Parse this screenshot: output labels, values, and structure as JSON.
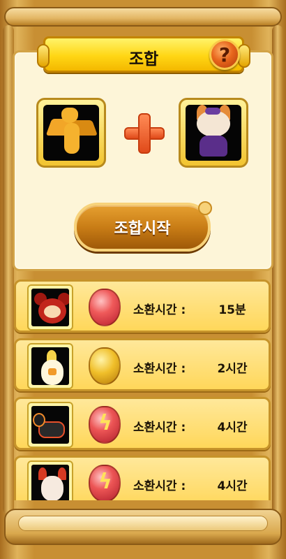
{
  "header": {
    "title": "조합",
    "help_label": "?"
  },
  "combine": {
    "slot_left_icon": "dragon-creature",
    "slot_right_icon": "fox-wizard-creature",
    "operator": "+",
    "start_button_label": "조합시작"
  },
  "summon_list": [
    {
      "creature_icon": "red-tanuki-creature",
      "gem": "red-gem",
      "label": "소환시간 :",
      "value": "15분"
    },
    {
      "creature_icon": "yellow-chick-creature",
      "gem": "gold-gem",
      "label": "소환시간 :",
      "value": "2시간"
    },
    {
      "creature_icon": "black-fire-horse-creature",
      "gem": "red-bolt-gem",
      "label": "소환시간 :",
      "value": "4시간"
    },
    {
      "creature_icon": "fire-fox-creature",
      "gem": "red-bolt-gem",
      "label": "소환시간 :",
      "value": "4시간"
    }
  ],
  "colors": {
    "banner": "#ffd614",
    "button": "#c97d16",
    "panel": "#fdf5d8",
    "row": "#ffe89a",
    "frame": "#c88f33"
  }
}
